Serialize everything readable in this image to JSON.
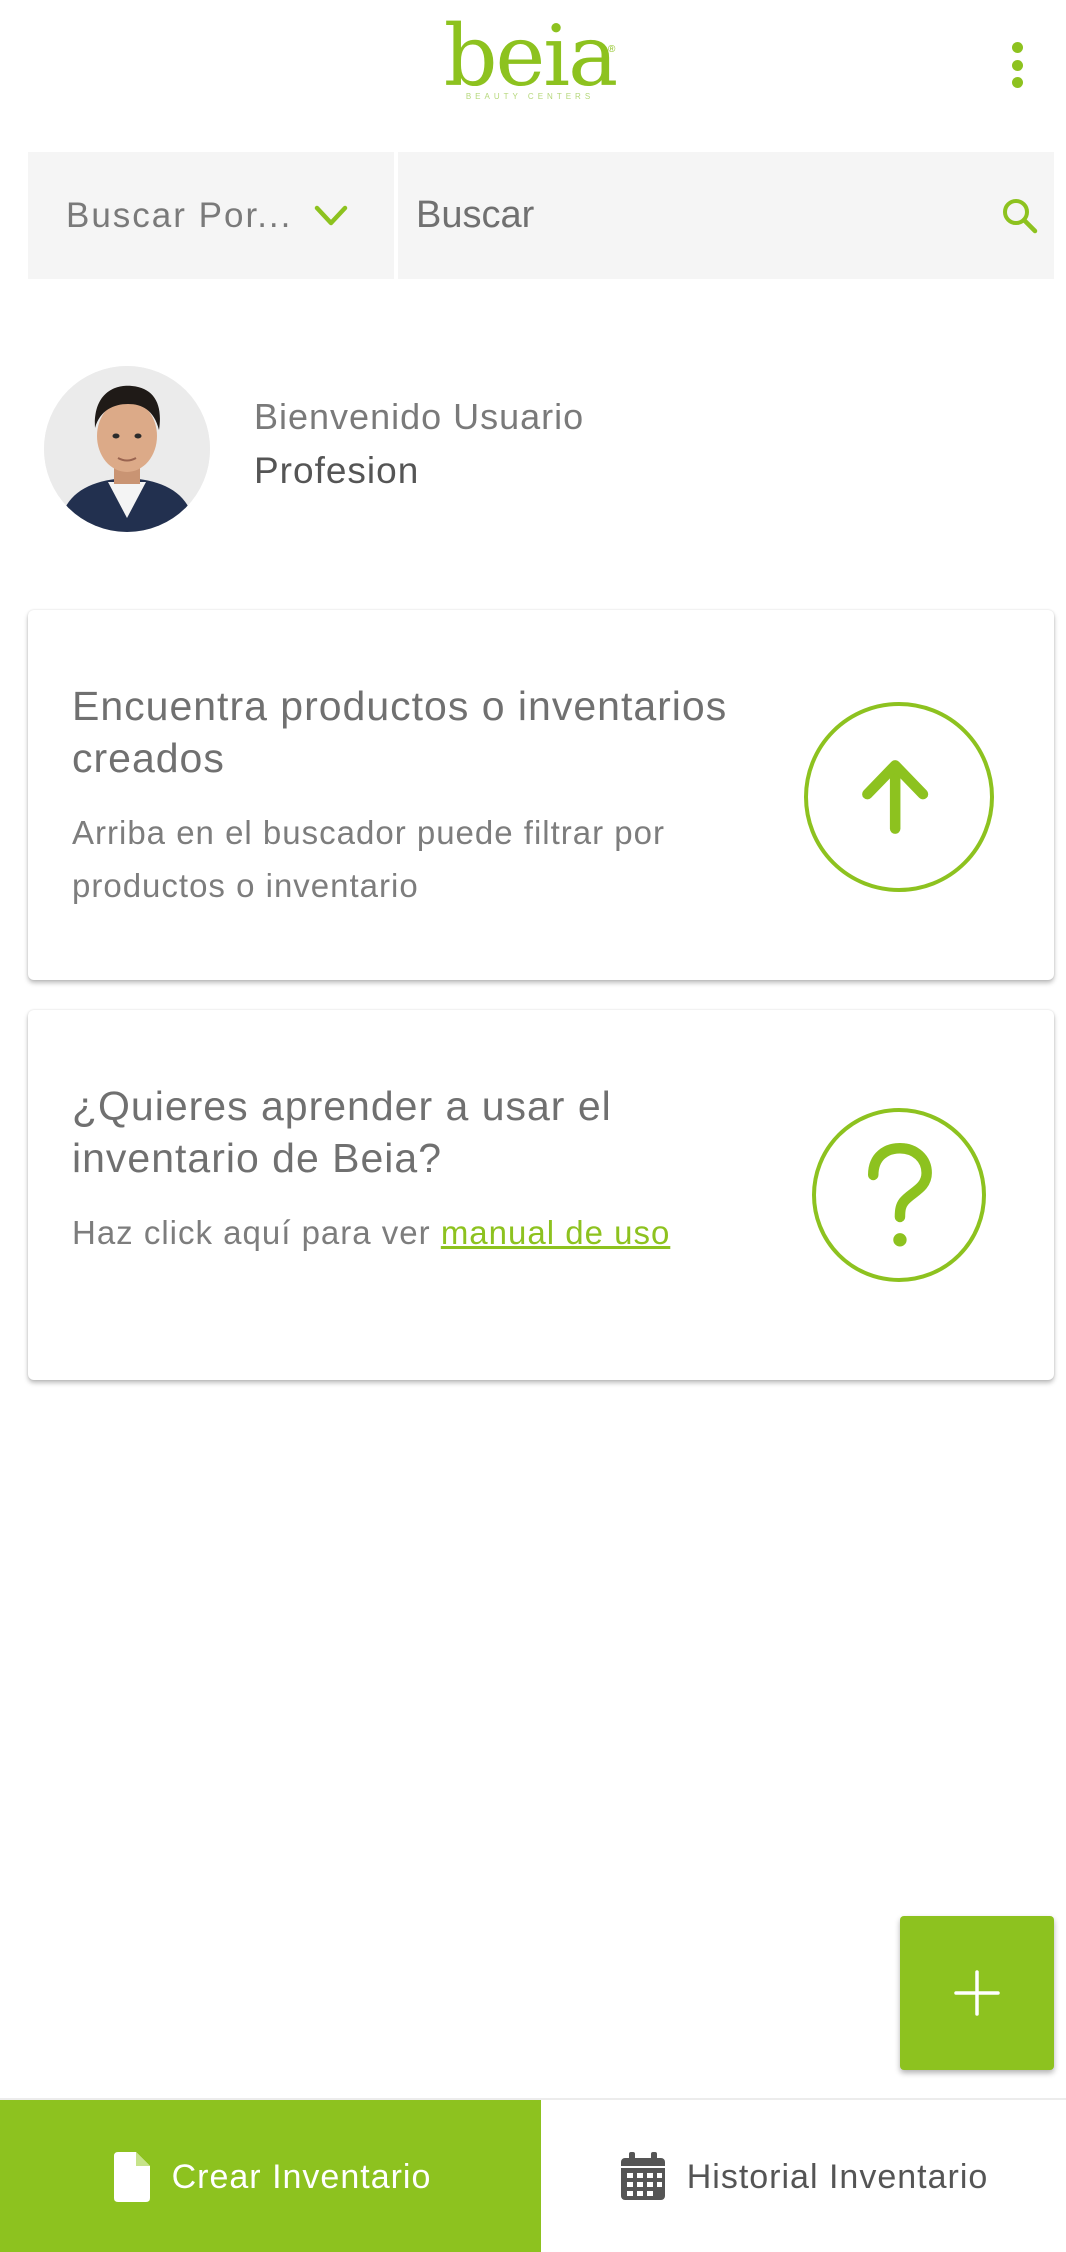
{
  "header": {
    "logo_text": "beia",
    "logo_reg": "®",
    "logo_sub": "BEAUTY CENTERS",
    "menu_icon": "more-vertical-icon"
  },
  "search": {
    "filter_label": "Buscar Por...",
    "filter_icon": "chevron-down-icon",
    "placeholder": "Buscar",
    "icon": "search-icon"
  },
  "profile": {
    "greeting": "Bienvenido Usuario",
    "profession": "Profesion"
  },
  "cards": [
    {
      "title": "Encuentra productos o inventarios creados",
      "text": "Arriba en el buscador puede filtrar por productos o inventario",
      "icon": "arrow-up-circle-icon"
    },
    {
      "title": "¿Quieres aprender a usar el inventario de Beia?",
      "text": "Haz click aquí para ver ",
      "link": "manual de uso",
      "icon": "question-circle-icon"
    }
  ],
  "fab": {
    "icon": "plus-icon"
  },
  "bottom_nav": [
    {
      "label": "Crear Inventario",
      "icon": "file-icon",
      "active": true
    },
    {
      "label": "Historial Inventario",
      "icon": "calendar-icon",
      "active": false
    }
  ],
  "colors": {
    "accent": "#8dc21f",
    "text": "#707070",
    "search_bg": "#f5f5f5"
  }
}
